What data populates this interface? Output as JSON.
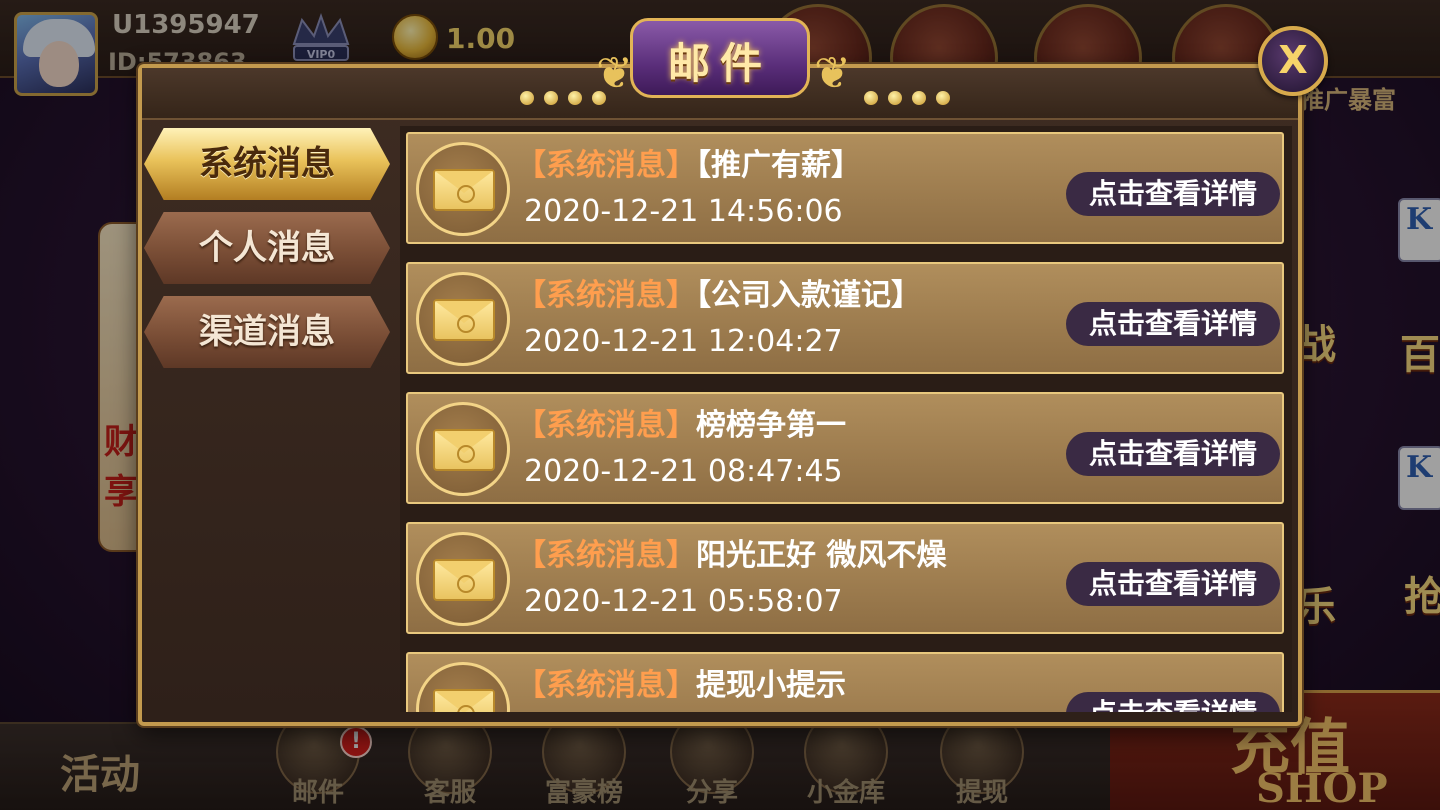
{
  "header": {
    "username": "U1395947",
    "user_id": "ID:573863",
    "vip_label": "VIP0",
    "balance": "1.00",
    "promo_text": "推广暴富"
  },
  "side_promo": {
    "chars": [
      "财",
      "享"
    ]
  },
  "right_panel": {
    "card_letter": "K",
    "chars": [
      "战",
      "百",
      "乐",
      "抢"
    ]
  },
  "dialog": {
    "title": "邮件",
    "close_label": "X",
    "tabs": [
      {
        "label": "系统消息",
        "active": true
      },
      {
        "label": "个人消息",
        "active": false
      },
      {
        "label": "渠道消息",
        "active": false
      }
    ],
    "messages": [
      {
        "tag": "【系统消息】",
        "subject": "【推广有薪】",
        "date": "2020-12-21 14:56:06",
        "button": "点击查看详情"
      },
      {
        "tag": "【系统消息】",
        "subject": "【公司入款谨记】",
        "date": "2020-12-21 12:04:27",
        "button": "点击查看详情"
      },
      {
        "tag": "【系统消息】",
        "subject": "榜榜争第一",
        "date": "2020-12-21 08:47:45",
        "button": "点击查看详情"
      },
      {
        "tag": "【系统消息】",
        "subject": "阳光正好 微风不燥",
        "date": "2020-12-21 05:58:07",
        "button": "点击查看详情"
      },
      {
        "tag": "【系统消息】",
        "subject": "提现小提示",
        "date": "",
        "button": "点击查看详情"
      }
    ]
  },
  "bottom_nav": {
    "activity": "活动",
    "items": [
      {
        "label": "邮件",
        "icon": "mail-icon"
      },
      {
        "label": "客服",
        "icon": "support-icon"
      },
      {
        "label": "富豪榜",
        "icon": "leaderboard-icon"
      },
      {
        "label": "分享",
        "icon": "share-icon"
      },
      {
        "label": "小金库",
        "icon": "vault-icon"
      },
      {
        "label": "提现",
        "icon": "withdraw-icon"
      }
    ],
    "mail_badge": "!",
    "shop_cn": "充值",
    "shop_en": "SHOP"
  },
  "colors": {
    "accent_gold": "#c39a4e",
    "tag_orange": "#ff9e4e",
    "button_purple": "#3a2a44"
  }
}
